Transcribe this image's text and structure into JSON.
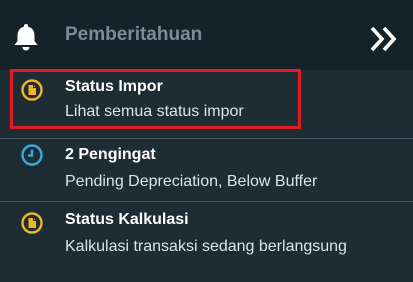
{
  "header": {
    "title": "Pemberitahuan",
    "bell_icon": "bell-icon",
    "collapse_icon": "double-chevron-right-icon"
  },
  "items": [
    {
      "title": "Status Impor",
      "subtitle": "Lihat semua status impor",
      "icon": "document-icon",
      "icon_color": "#f0b429",
      "highlighted": true
    },
    {
      "title": "2 Pengingat",
      "subtitle": "Pending Depreciation, Below Buffer",
      "icon": "clock-icon",
      "icon_color": "#3aa8e0"
    },
    {
      "title": "Status Kalkulasi",
      "subtitle": "Kalkulasi transaksi sedang berlangsung",
      "icon": "document-icon",
      "icon_color": "#f0b429"
    }
  ],
  "colors": {
    "background": "#1e2c34",
    "header_background": "#162229",
    "highlight_border": "#e01b24"
  }
}
